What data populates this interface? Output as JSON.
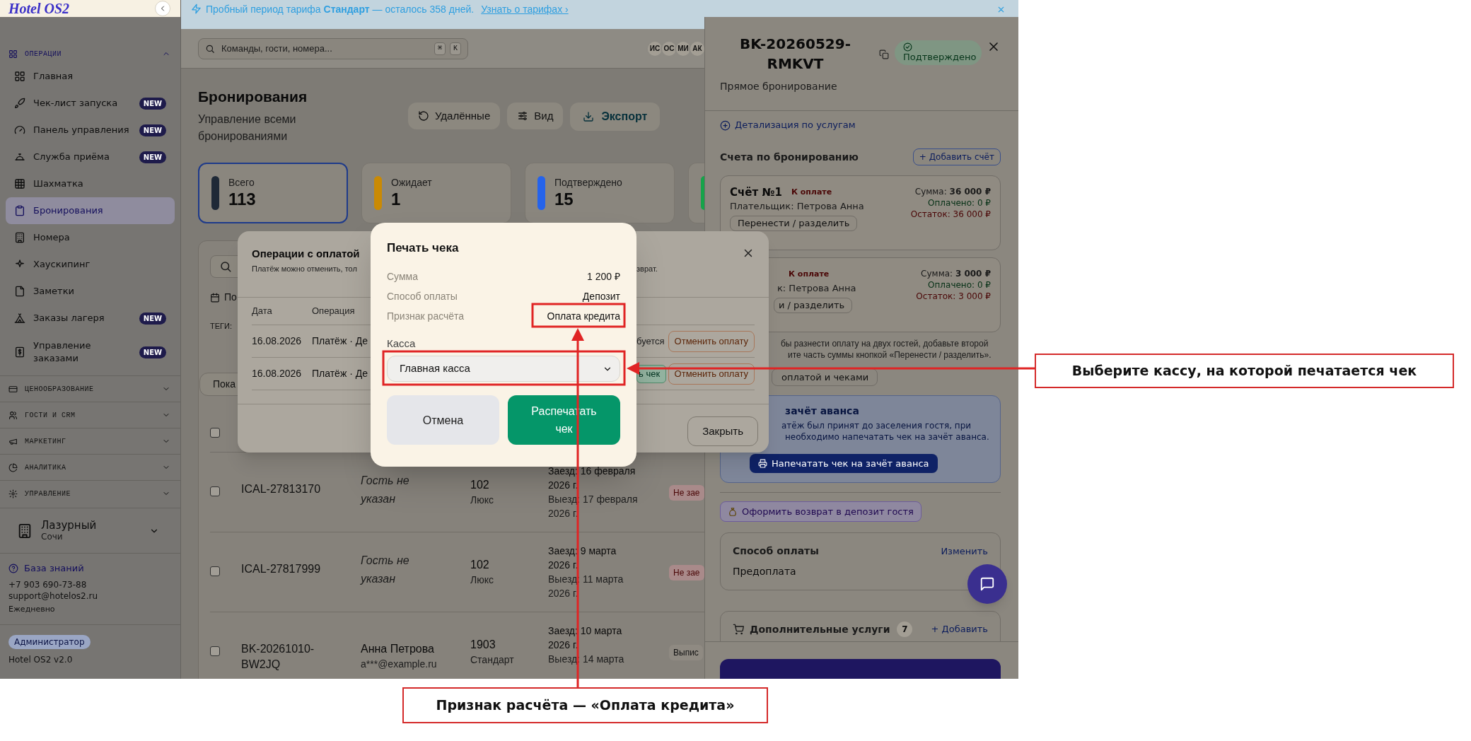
{
  "banner": {
    "text": "Пробный период тарифа **Стандарт** — осталось 358 дней.",
    "link": "Узнать о тарифах ›"
  },
  "sidebar": {
    "brand": "Hotel OS2",
    "sections": [
      {
        "title": "ОПЕРАЦИИ",
        "expanded": true,
        "items": [
          {
            "label": "Главная",
            "selected": false
          },
          {
            "label": "Чек-лист запуска",
            "badge": "NEW",
            "selected": false
          },
          {
            "label": "Панель управления",
            "badge": "NEW",
            "selected": false
          },
          {
            "label": "Служба приёма",
            "badge": "NEW",
            "selected": false
          },
          {
            "label": "Шахматка",
            "selected": false
          },
          {
            "label": "Бронирования",
            "selected": true
          },
          {
            "label": "Номера",
            "selected": false
          },
          {
            "label": "Хаускипинг",
            "selected": false
          },
          {
            "label": "Заметки",
            "selected": false
          },
          {
            "label": "Заказы лагеря",
            "badge": "NEW",
            "selected": false
          },
          {
            "label": "Управление заказами",
            "badge": "NEW",
            "selected": false
          }
        ]
      },
      {
        "title": "ЦЕНООБРАЗОВАНИЕ",
        "expanded": false
      },
      {
        "title": "ГОСТИ И CRM",
        "expanded": false
      },
      {
        "title": "МАРКЕТИНГ",
        "expanded": false
      },
      {
        "title": "АНАЛИТИКА",
        "expanded": false
      },
      {
        "title": "УПРАВЛЕНИЕ",
        "expanded": false
      }
    ],
    "property": {
      "name": "Лазурный",
      "city": "Сочи"
    },
    "help": {
      "link": "База знаний",
      "phone": "+7 903 690-73-88",
      "email": "support@hotelos2.ru",
      "hours": "Ежедневно"
    },
    "role": "Администратор",
    "version": "Hotel OS2 v2.0"
  },
  "header": {
    "search_placeholder": "Команды, гости, номера...",
    "shortcut": [
      "⌘",
      "K"
    ],
    "avatars": [
      "ИС",
      "ОС",
      "МИ",
      "АК"
    ]
  },
  "page": {
    "title": "Бронирования",
    "subtitle": "Управление всеми бронированиями",
    "actions": [
      {
        "label": "Удалённые",
        "kind": "plain"
      },
      {
        "label": "Вид",
        "kind": "plain"
      },
      {
        "label": "Экспорт",
        "kind": "accent"
      }
    ],
    "stats": [
      {
        "label": "Всего",
        "value": "113",
        "color": "#1f2937",
        "selected": true
      },
      {
        "label": "Ожидает",
        "value": "1",
        "color": "#ca8a04",
        "selected": false
      },
      {
        "label": "Подтверждено",
        "value": "15",
        "color": "#2563eb",
        "selected": false
      },
      {
        "color": "#16a34a",
        "selected": false
      }
    ]
  },
  "bookings": {
    "filter_label": "По",
    "tags_label": "ТЕГИ:",
    "show_button": "Пока",
    "all_selected": false,
    "rows": [
      {
        "id": "ICAL-27813170",
        "guest": "Гость не указан",
        "guest_known": false,
        "room": "102",
        "room_type": "Люкс",
        "checkin": "Заезд: 16 февраля 2026 г.",
        "checkout": "Выезд: 17 февраля 2026 г.",
        "status": {
          "text": "Не зае",
          "kind": "warning"
        },
        "selected": false
      },
      {
        "id": "ICAL-27817999",
        "guest": "Гость не указан",
        "guest_known": false,
        "room": "102",
        "room_type": "Люкс",
        "checkin": "Заезд: 9 марта 2026 г.",
        "checkout": "Выезд: 11 марта 2026 г.",
        "status": {
          "text": "Не зае",
          "kind": "warning"
        },
        "selected": false
      },
      {
        "id": "BK-20261010-BW2JQ",
        "guest": "Анна Петрова",
        "email": "a***@example.ru",
        "guest_known": true,
        "room": "1903",
        "room_type": "Стандарт",
        "checkin": "Заезд: 10 марта 2026 г.",
        "checkout": "Выезд: 14 марта",
        "status": {
          "text": "Выпис",
          "kind": "neutral"
        },
        "selected": false
      }
    ]
  },
  "booking_panel": {
    "title": "BK-20260529-RMKVT",
    "status": "Подтверждено",
    "source": "Прямое бронирование",
    "details_link": "Детализация по услугам",
    "invoices_title": "Счета по бронированию",
    "add_invoice": "+ Добавить счёт",
    "invoices": [
      {
        "title": "Счёт №1",
        "status": "К оплате",
        "payer": "Плательщик: Петрова Анна",
        "sum": "Сумма: **36 000 ₽**",
        "paid": "Оплачено: 0 ₽",
        "rest": "Остаток: 36 000 ₽",
        "action": "Перенести / разделить"
      },
      {
        "status": "К оплате",
        "payer": "к: Петрова Анна",
        "sum": "Сумма: **3 000 ₽**",
        "paid": "Оплачено: 0 ₽",
        "rest": "Остаток: 3 000 ₽",
        "action": "и / разделить"
      }
    ],
    "tip_lines": [
      "бы разнести оплату на двух гостей, добавьте второй",
      "ите часть суммы кнопкой «Перенести / разделить»."
    ],
    "payments_button": "оплатой и чеками",
    "advance": {
      "title": "зачёт аванса",
      "lines": [
        "атёж был принят до заселения гостя, при",
        "необходимо напечатать чек на зачёт аванса."
      ],
      "button": "Напечатать чек на зачёт аванса"
    },
    "refund_button": "Оформить возврат в депозит гостя",
    "payment_method": {
      "title": "Способ оплаты",
      "link": "Изменить",
      "value": "Предоплата"
    },
    "extras": {
      "title": "Дополнительные услуги",
      "count": "7",
      "link": "+ Добавить"
    }
  },
  "payments_dialog": {
    "title": "Операции с оплатой",
    "subtitle": "Платёж можно отменить, тол",
    "subtitle_end": "зврат.",
    "columns": [
      "Дата",
      "Операция"
    ],
    "rows": [
      {
        "date": "16.08.2026",
        "operation": "Платёж · Де",
        "note": {
          "text": "буется",
          "kind": "text"
        },
        "action": "Отменить оплату"
      },
      {
        "date": "16.08.2026",
        "operation": "Платёж · Де",
        "note": {
          "text": "ь чек",
          "kind": "badge"
        },
        "action": "Отменить оплату"
      }
    ],
    "close_button": "Закрыть"
  },
  "print_dialog": {
    "title": "Печать чека",
    "rows": [
      {
        "label": "Сумма",
        "value": "1 200 ₽"
      },
      {
        "label": "Способ оплаты",
        "value": "Депозит"
      },
      {
        "label": "Признак расчёта",
        "value": "Оплата кредита"
      }
    ],
    "register_label": "Касса",
    "register_value": "Главная касса",
    "buttons": [
      {
        "label": "Отмена",
        "kind": "secondary"
      },
      {
        "label": "Распечатать чек",
        "kind": "primary"
      }
    ]
  },
  "annotations": [
    {
      "text": "Выберите кассу, на которой печатается чек"
    },
    {
      "text": "Признак расчёта — «Оплата кредита»"
    }
  ]
}
